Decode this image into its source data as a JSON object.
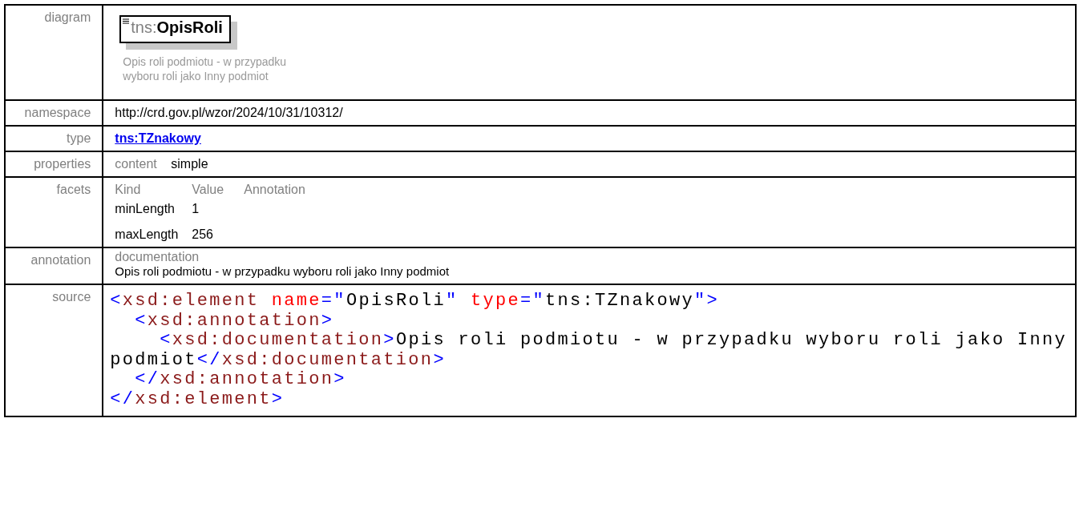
{
  "rows": [
    {
      "kind": "diagram",
      "label": "diagram",
      "element": {
        "prefix": "tns:",
        "name": "OpisRoli"
      },
      "description": "Opis roli podmiotu - w przypadku wyboru roli jako Inny podmiot"
    },
    {
      "kind": "text",
      "label": "namespace",
      "value": "http://crd.gov.pl/wzor/2024/10/31/10312/"
    },
    {
      "kind": "link",
      "label": "type",
      "value": "tns:TZnakowy"
    },
    {
      "kind": "properties",
      "label": "properties",
      "pairs": [
        {
          "key": "content",
          "value": "simple"
        }
      ]
    },
    {
      "kind": "facets",
      "label": "facets",
      "columns": [
        "Kind",
        "Value",
        "Annotation"
      ],
      "items": [
        {
          "kind": "minLength",
          "value": "1"
        },
        {
          "kind": "maxLength",
          "value": "256"
        }
      ]
    },
    {
      "kind": "annotation",
      "label": "annotation",
      "heading": "documentation",
      "text": "Opis roli podmiotu - w przypadku wyboru roli jako Inny podmiot"
    },
    {
      "kind": "source",
      "label": "source",
      "lines": [
        [
          {
            "kind": "punct",
            "text": "<"
          },
          {
            "kind": "tag",
            "text": "xsd:element"
          },
          {
            "kind": "attr",
            "text": " name"
          },
          {
            "kind": "punct",
            "text": "=\""
          },
          {
            "kind": "value",
            "text": "OpisRoli"
          },
          {
            "kind": "punct",
            "text": "\""
          },
          {
            "kind": "attr",
            "text": " type"
          },
          {
            "kind": "punct",
            "text": "=\""
          },
          {
            "kind": "value",
            "text": "tns:TZnakowy"
          },
          {
            "kind": "punct",
            "text": "\">"
          }
        ],
        [
          {
            "kind": "punct",
            "text": "  <"
          },
          {
            "kind": "tag",
            "text": "xsd:annotation"
          },
          {
            "kind": "punct",
            "text": ">"
          }
        ],
        [
          {
            "kind": "punct",
            "text": "    <"
          },
          {
            "kind": "tag",
            "text": "xsd:documentation"
          },
          {
            "kind": "punct",
            "text": ">"
          },
          {
            "kind": "value",
            "text": "Opis roli podmiotu - w przypadku wyboru roli jako Inny"
          }
        ],
        [
          {
            "kind": "value",
            "text": "podmiot"
          },
          {
            "kind": "punct",
            "text": "</"
          },
          {
            "kind": "tag",
            "text": "xsd:documentation"
          },
          {
            "kind": "punct",
            "text": ">"
          }
        ],
        [
          {
            "kind": "punct",
            "text": "  </"
          },
          {
            "kind": "tag",
            "text": "xsd:annotation"
          },
          {
            "kind": "punct",
            "text": ">"
          }
        ],
        [
          {
            "kind": "punct",
            "text": "</"
          },
          {
            "kind": "tag",
            "text": "xsd:element"
          },
          {
            "kind": "punct",
            "text": ">"
          }
        ]
      ]
    }
  ]
}
